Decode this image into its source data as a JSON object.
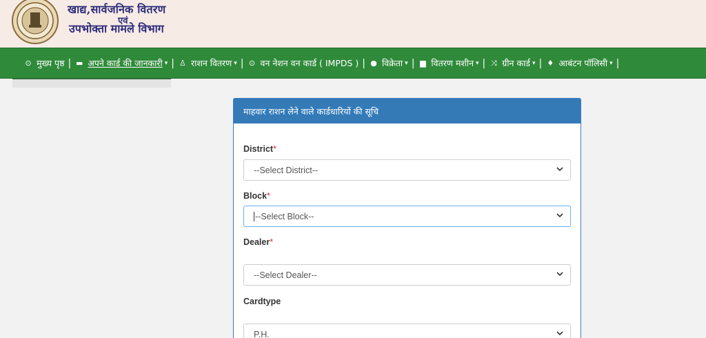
{
  "header": {
    "title_line1": "खाद्य,सार्वजनिक वितरण",
    "title_line2": "एवं",
    "title_line3": "उपभोक्ता मामले विभाग"
  },
  "nav": {
    "items": [
      {
        "label": "मुख्य पृष्ठ",
        "icon": "dashboard-icon",
        "has_caret": false
      },
      {
        "label": "अपने कार्ड की जानकारी",
        "icon": "card-icon",
        "has_caret": true,
        "active": true
      },
      {
        "label": "राशन वितरण",
        "icon": "person-icon",
        "has_caret": true
      },
      {
        "label": "वन नेशन वन कार्ड ( IMPDS )",
        "icon": "dashboard-icon",
        "has_caret": false
      },
      {
        "label": "विक्रेता",
        "icon": "user-icon",
        "has_caret": true
      },
      {
        "label": "वितरण मशीन",
        "icon": "machine-icon",
        "has_caret": true
      },
      {
        "label": "ग्रीन कार्ड",
        "icon": "shuffle-icon",
        "has_caret": true
      },
      {
        "label": "आबंटन पॉलिसी",
        "icon": "leaf-icon",
        "has_caret": true
      }
    ]
  },
  "panel": {
    "title": "माहवार राशन लेने वाले कार्डधारियों की सूचि",
    "fields": {
      "district": {
        "label": "District",
        "required_mark": "*",
        "value": "--Select District--"
      },
      "block": {
        "label": "Block",
        "required_mark": "*",
        "value": "--Select Block--"
      },
      "dealer": {
        "label": "Dealer",
        "required_mark": "*",
        "value": "--Select Dealer--"
      },
      "cardtype": {
        "label": "Cardtype",
        "value": "P.H."
      }
    }
  },
  "colors": {
    "nav_green": "#2f8a3a",
    "panel_blue": "#337ab7",
    "required_red": "#c9302c",
    "header_bg": "#f7ebe6"
  }
}
